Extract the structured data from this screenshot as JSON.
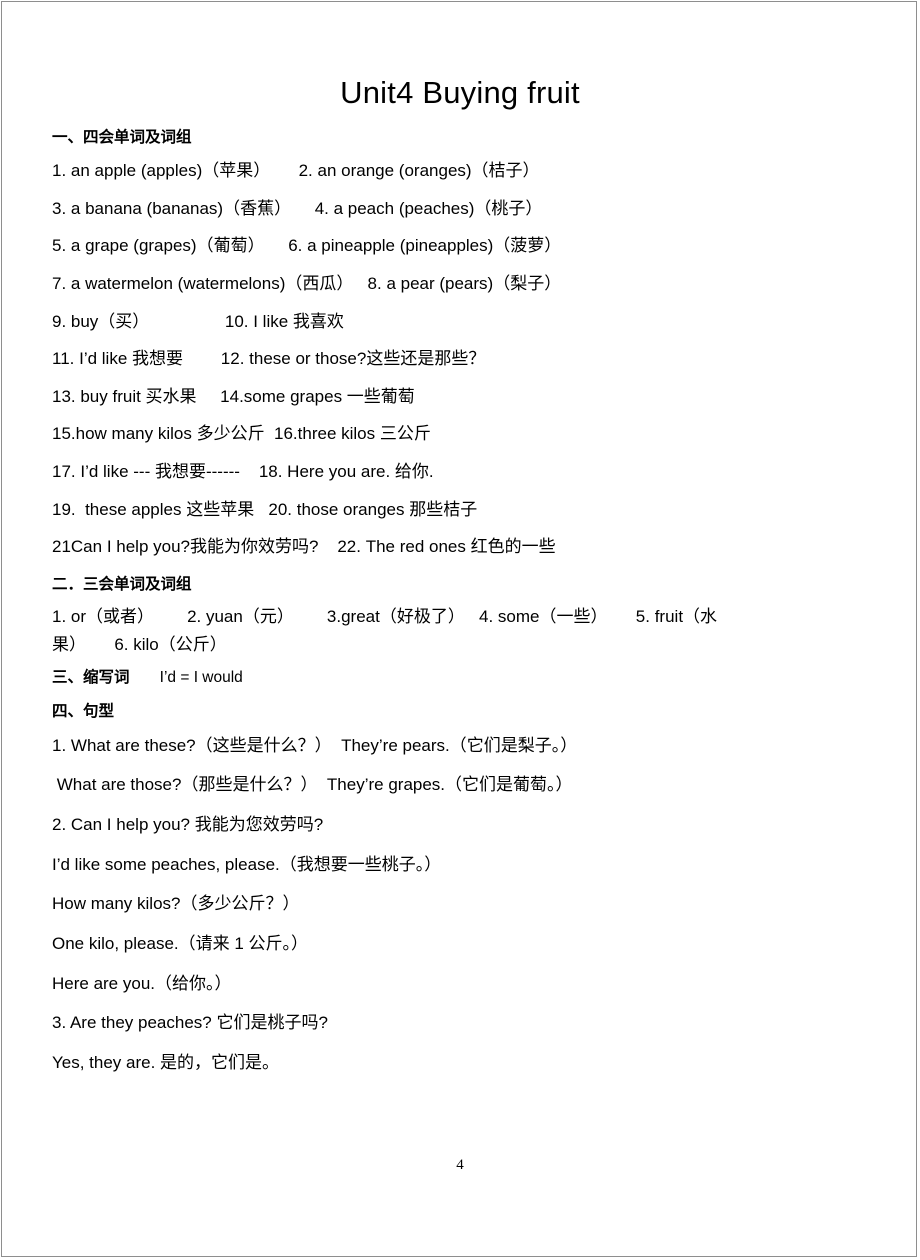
{
  "document": {
    "title": "Unit4 Buying fruit",
    "page_number": "4",
    "border_color": "#8e8e8e"
  },
  "sections": {
    "one": {
      "heading": "一、四会单词及词组",
      "lines": [
        "1. an apple (apples)（苹果）      2. an orange (oranges)（桔子）",
        "3. a banana (bananas)（香蕉）     4. a peach (peaches)（桃子）",
        "5. a grape (grapes)（葡萄）     6. a pineapple (pineapples)（菠萝）",
        "7. a watermelon (watermelons)（西瓜）   8. a pear (pears)（梨子）",
        "9. buy（买）                10. I like 我喜欢",
        "11. I’d like 我想要        12. these or those?这些还是那些？",
        "13. buy fruit 买水果     14.some grapes 一些葡萄",
        "15.how many kilos 多少公斤  16.three kilos 三公斤",
        "17. I’d like --- 我想要------    18. Here you are. 给你.",
        "19.  these apples 这些苹果   20. those oranges 那些桔子",
        "21Can I help you?我能为你效劳吗?    22. The red ones 红色的一些"
      ]
    },
    "two": {
      "heading": "二．三会单词及词组",
      "line_main": "1. or（或者）       2. yuan（元）       3.great（好极了）   4. some（一些）      5. fruit（水",
      "line_cont": "果）      6. kilo（公斤）"
    },
    "three": {
      "heading": "三、缩写词",
      "heading_extra": "       I’d = I would"
    },
    "four": {
      "heading": "四、句型",
      "lines": [
        "1. What are these?（这些是什么？）  They’re pears.（它们是梨子。）",
        " What are those?（那些是什么？）  They’re grapes.（它们是葡萄。）",
        "2. Can I help you? 我能为您效劳吗?",
        "I’d like some peaches, please.（我想要一些桃子。）",
        "How many kilos?（多少公斤？）",
        "One kilo, please.（请来 1 公斤。）",
        "Here are you.（给你。）",
        "3. Are they peaches? 它们是桃子吗?",
        "Yes, they are. 是的，它们是。"
      ]
    }
  }
}
